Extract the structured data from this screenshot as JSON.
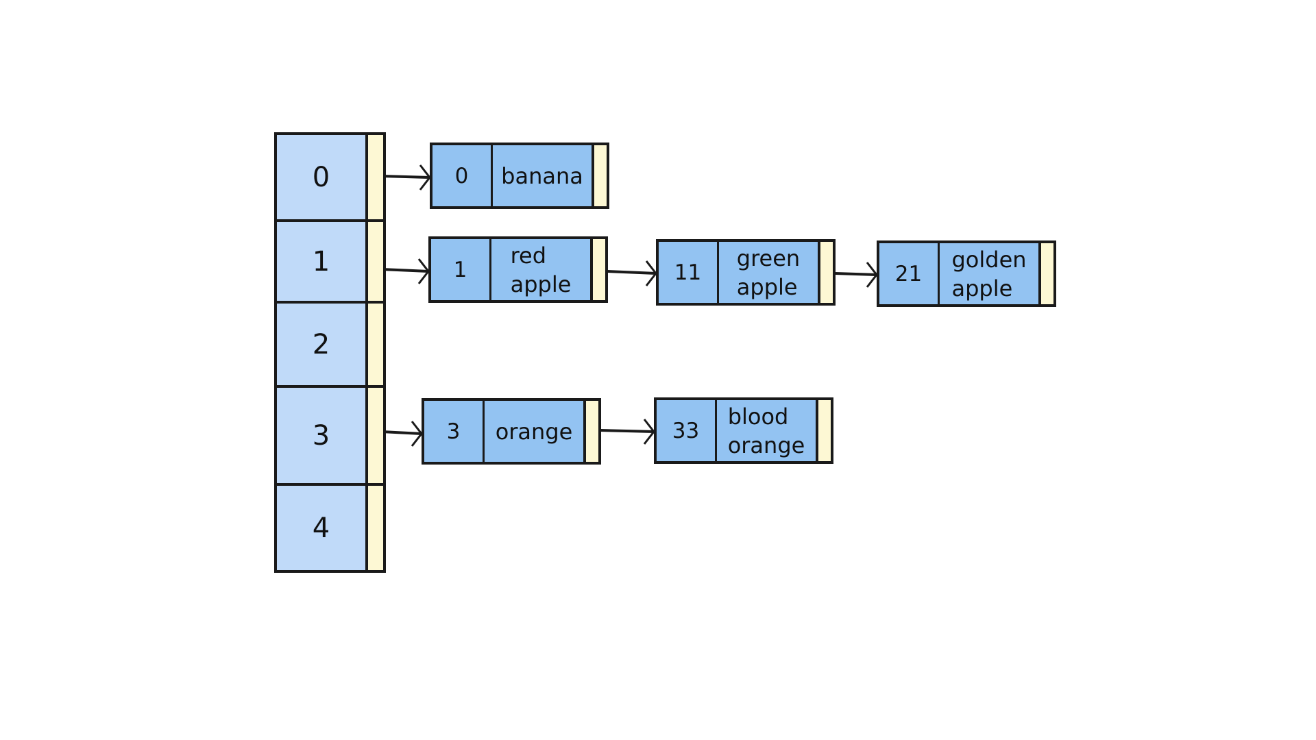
{
  "diagram": {
    "type": "hash-table-separate-chaining",
    "colors": {
      "bucket_fill": "#c0daf9",
      "node_fill": "#93c3f2",
      "pointer_fill": "#fdf8d4",
      "stroke": "#1a1a1a"
    },
    "buckets": [
      {
        "index": "0",
        "chain": [
          {
            "key": "0",
            "value": [
              "banana"
            ]
          }
        ]
      },
      {
        "index": "1",
        "chain": [
          {
            "key": "1",
            "value": [
              "red",
              "apple"
            ]
          },
          {
            "key": "11",
            "value": [
              "green",
              "apple"
            ]
          },
          {
            "key": "21",
            "value": [
              "golden",
              "apple"
            ]
          }
        ]
      },
      {
        "index": "2",
        "chain": []
      },
      {
        "index": "3",
        "chain": [
          {
            "key": "3",
            "value": [
              "orange"
            ]
          },
          {
            "key": "33",
            "value": [
              "blood",
              "orange"
            ]
          }
        ]
      },
      {
        "index": "4",
        "chain": []
      }
    ]
  }
}
